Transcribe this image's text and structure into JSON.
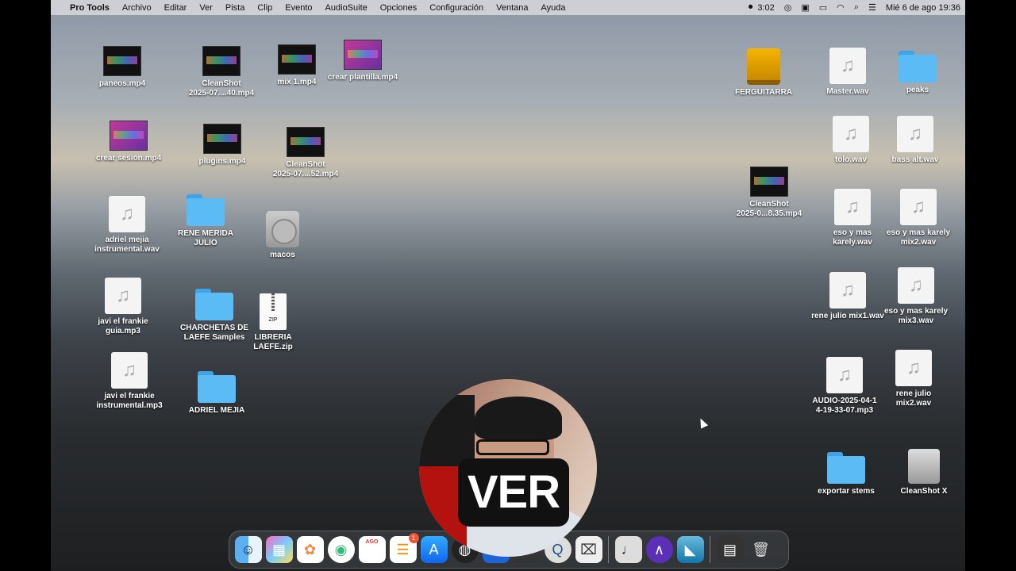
{
  "menubar": {
    "apple": "",
    "app_name": "Pro Tools",
    "menus": [
      "Archivo",
      "Editar",
      "Ver",
      "Pista",
      "Clip",
      "Evento",
      "AudioSuite",
      "Opciones",
      "Configuración",
      "Ventana",
      "Ayuda"
    ],
    "record_time": "3:02",
    "date_time": "Mié 6 de ago  19:36"
  },
  "desktop": {
    "icons": {
      "paneos": "paneos.mp4",
      "cleanshot1": "CleanShot\n2025-07....40.mp4",
      "mix1": "mix 1.mp4",
      "crear_plantilla": "crear plantilla.mp4",
      "crear_sesion": "crear sesion.mp4",
      "plugins": "plugins.mp4",
      "cleanshot2": "CleanShot\n2025-07....52.mp4",
      "adriel_inst": "adriel mejia\ninstrumental.wav",
      "rene_merida": "RENE MERIDA\nJULIO",
      "macos": "macos",
      "javi_guia": "javi el frankie\nguia.mp3",
      "charchetas": "CHARCHETAS DE\nLAEFE Samples",
      "libreria": "LIBRERIA\nLAEFE.zip",
      "zip_tag": "ZIP",
      "javi_inst": "javi el frankie\ninstrumental.mp3",
      "adriel_folder": "ADRIEL MEJIA",
      "ferguitarra": "FERGUITARRA",
      "master": "Master.wav",
      "peaks": "peaks",
      "tolo": "tolo.wav",
      "bass_alt": "bass alt.wav",
      "cleanshot3": "CleanShot\n2025-0...8.35.mp4",
      "eso_karely": "eso y mas\nkarely.wav",
      "eso_mix2": "eso y mas karely\nmix2.wav",
      "rene_mix1": "rene julio mix1.wav",
      "eso_mix3": "eso y mas karely\nmix3.wav",
      "audio_2025": "AUDIO-2025-04-1\n4-19-33-07.mp3",
      "rene_mix2": "rene julio\nmix2.wav",
      "exportar": "exportar stems",
      "cleanshot_x": "CleanShot X"
    }
  },
  "overlay": {
    "caption": "VER"
  },
  "dock": {
    "calendar_month": "AGO",
    "calendar_day": "6",
    "reminders_badge": "1",
    "items": [
      "finder-icon",
      "launchpad-icon",
      "photos-icon",
      "chrome-icon",
      "calendar-icon",
      "reminders-icon",
      "app-store-icon",
      "siri-icon",
      "unknown-icon",
      "unknown2-icon",
      "quicktime-icon",
      "screenshot-icon",
      "audio-midi-icon",
      "avid-icon",
      "cleanshot-icon",
      "pro-tools-icon",
      "trash-icon"
    ]
  },
  "colors": {
    "folder": "#5bbcf5",
    "badge": "#e53",
    "caption_bg": "#111"
  }
}
